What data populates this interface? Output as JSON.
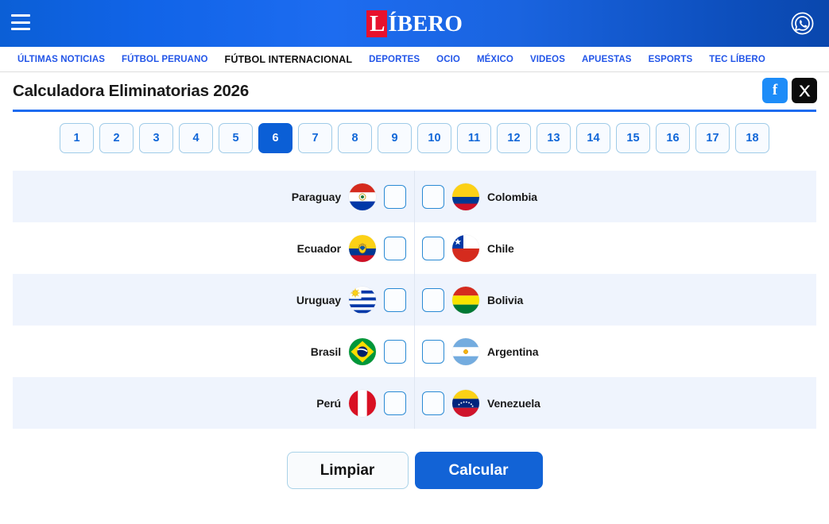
{
  "header": {
    "menu_icon": "hamburger-icon",
    "logo_accent_letter": "L",
    "logo_rest": "ÍBERO",
    "logo_full": "LÍBERO",
    "whatsapp_icon": "whatsapp-icon",
    "bg_color": "#1164e8",
    "logo_accent_color": "#e8112d"
  },
  "nav": {
    "items": [
      {
        "label": "ÚLTIMAS NOTICIAS",
        "active": false
      },
      {
        "label": "FÚTBOL PERUANO",
        "active": false
      },
      {
        "label": "FÚTBOL INTERNACIONAL",
        "active": true
      },
      {
        "label": "DEPORTES",
        "active": false
      },
      {
        "label": "OCIO",
        "active": false
      },
      {
        "label": "MÉXICO",
        "active": false
      },
      {
        "label": "VIDEOS",
        "active": false
      },
      {
        "label": "APUESTAS",
        "active": false
      },
      {
        "label": "ESPORTS",
        "active": false
      },
      {
        "label": "TEC LÍBERO",
        "active": false
      }
    ],
    "link_color": "#2255e8",
    "active_color": "#111111"
  },
  "title": {
    "text": "Calculadora Eliminatorias 2026",
    "share_facebook": {
      "icon": "facebook-icon",
      "label": "f",
      "color": "#1d8cf8"
    },
    "share_x": {
      "icon": "x-twitter-icon",
      "label": "X",
      "color": "#0b0b0b"
    }
  },
  "pagination": {
    "pages": [
      "1",
      "2",
      "3",
      "4",
      "5",
      "6",
      "7",
      "8",
      "9",
      "10",
      "11",
      "12",
      "13",
      "14",
      "15",
      "16",
      "17",
      "18"
    ],
    "active_page": "6",
    "active_color": "#0b5fd6",
    "inactive_color": "#1167d8"
  },
  "matches": [
    {
      "home": "Paraguay",
      "home_flag": "paraguay-flag",
      "home_score": "",
      "away_score": "",
      "away": "Colombia",
      "away_flag": "colombia-flag"
    },
    {
      "home": "Ecuador",
      "home_flag": "ecuador-flag",
      "home_score": "",
      "away_score": "",
      "away": "Chile",
      "away_flag": "chile-flag"
    },
    {
      "home": "Uruguay",
      "home_flag": "uruguay-flag",
      "home_score": "",
      "away_score": "",
      "away": "Bolivia",
      "away_flag": "bolivia-flag"
    },
    {
      "home": "Brasil",
      "home_flag": "brasil-flag",
      "home_score": "",
      "away_score": "",
      "away": "Argentina",
      "away_flag": "argentina-flag"
    },
    {
      "home": "Perú",
      "home_flag": "peru-flag",
      "home_score": "",
      "away_score": "",
      "away": "Venezuela",
      "away_flag": "venezuela-flag"
    }
  ],
  "actions": {
    "clear_label": "Limpiar",
    "calculate_label": "Calcular",
    "calculate_color": "#1263d6"
  }
}
